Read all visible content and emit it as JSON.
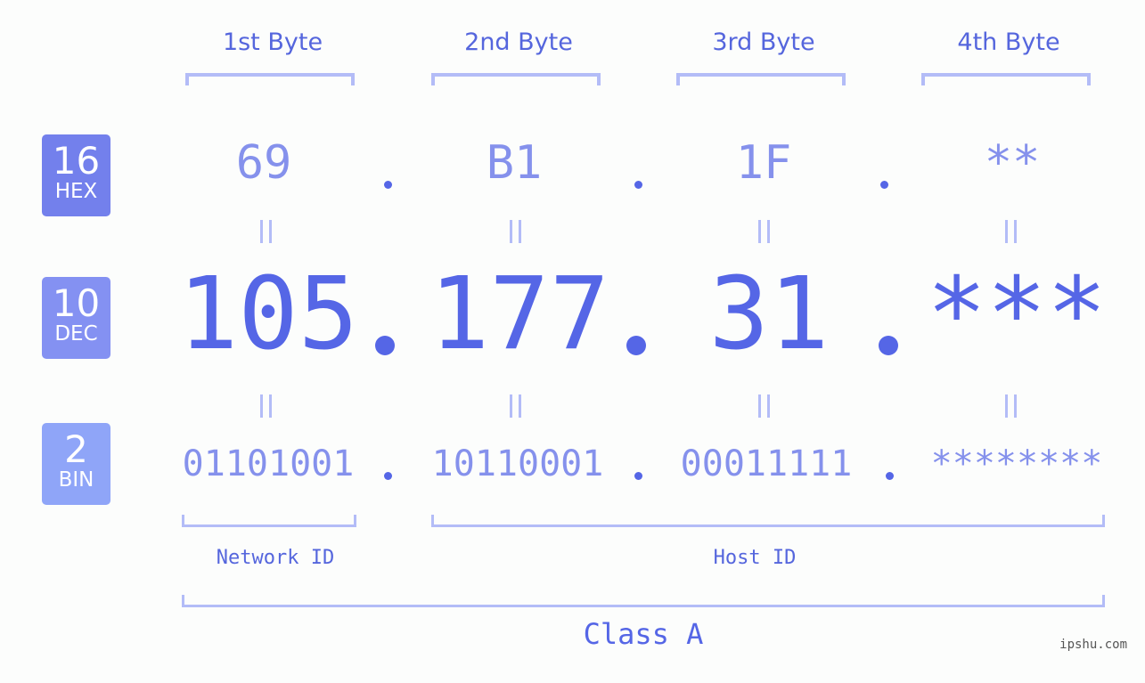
{
  "byte_headers": [
    "1st Byte",
    "2nd Byte",
    "3rd Byte",
    "4th Byte"
  ],
  "rows": {
    "hex": {
      "base": "16",
      "label": "HEX",
      "values": [
        "69",
        "B1",
        "1F",
        "**"
      ],
      "badge_color": "#7380ec"
    },
    "dec": {
      "base": "10",
      "label": "DEC",
      "values": [
        "105",
        "177",
        "31",
        "***"
      ],
      "badge_color": "#8491f2"
    },
    "bin": {
      "base": "2",
      "label": "BIN",
      "values": [
        "01101001",
        "10110001",
        "00011111",
        "********"
      ],
      "badge_color": "#8fa5f8"
    }
  },
  "separator": ".",
  "network_id_label": "Network ID",
  "host_id_label": "Host ID",
  "class_label": "Class A",
  "watermark": "ipshu.com",
  "colors": {
    "accent": "#5566e6",
    "light_text": "#8591ec",
    "bracket": "#b3bcf7",
    "background": "#fcfdfc"
  }
}
